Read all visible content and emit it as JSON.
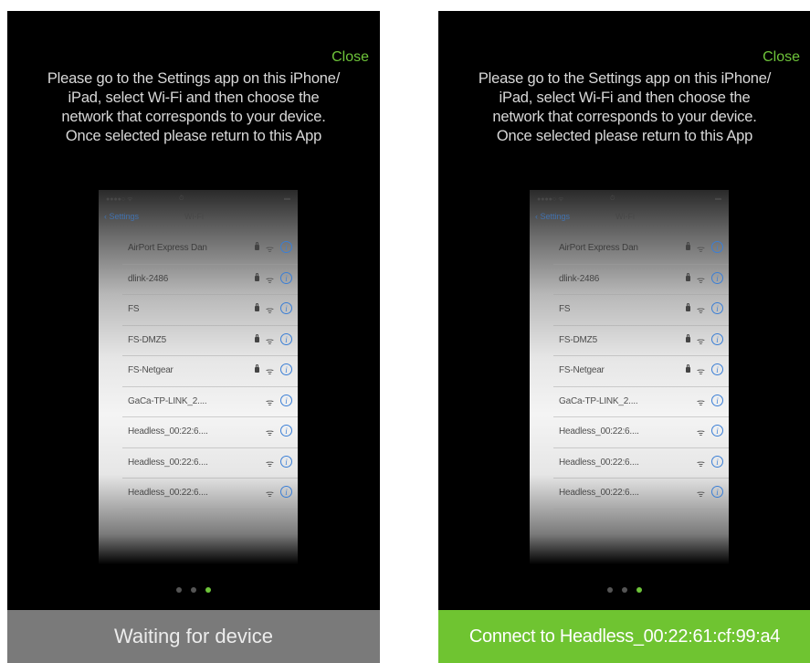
{
  "screens": [
    {
      "close_label": "Close",
      "instructions": [
        "Please go to the Settings app on this iPhone/",
        "iPad, select Wi-Fi and then choose the",
        "network that corresponds to your device.",
        "Once selected please return to this App"
      ],
      "bottom_label": "Waiting for device",
      "bottom_color": "#7a7a7a",
      "active_dot": 2
    },
    {
      "close_label": "Close",
      "instructions": [
        "Please go to the Settings app on this iPhone/",
        "iPad, select Wi-Fi and then choose the",
        "network that corresponds to your device.",
        "Once selected please return to this App"
      ],
      "bottom_label": "Connect to Headless_00:22:61:cf:99:a4",
      "bottom_color": "#6fc431",
      "active_dot": 2
    }
  ],
  "wifi_settings": {
    "back_label": "Settings",
    "title": "Wi-Fi",
    "networks": [
      {
        "name": "AirPort Express Dan",
        "locked": true
      },
      {
        "name": "dlink-2486",
        "locked": true
      },
      {
        "name": "FS",
        "locked": true
      },
      {
        "name": "FS-DMZ5",
        "locked": true
      },
      {
        "name": "FS-Netgear",
        "locked": true
      },
      {
        "name": "GaCa-TP-LINK_2....",
        "locked": false
      },
      {
        "name": "Headless_00:22:6....",
        "locked": false
      },
      {
        "name": "Headless_00:22:6....",
        "locked": false
      },
      {
        "name": "Headless_00:22:6....",
        "locked": false
      }
    ]
  },
  "accent_color": "#6ec43a"
}
